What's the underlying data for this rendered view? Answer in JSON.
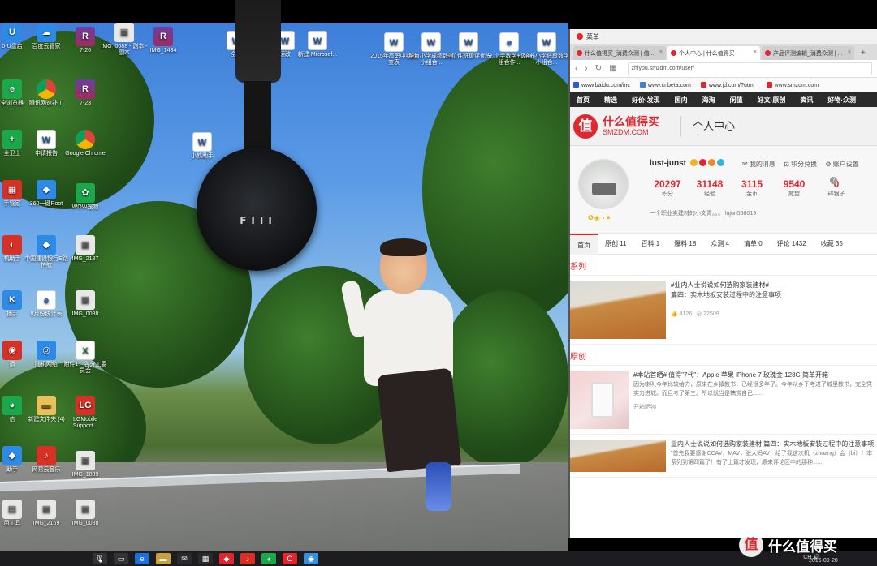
{
  "desktop": {
    "icons": [
      {
        "label": "0-U盘启",
        "icon": "app-icon",
        "cls": "shield",
        "glyph": "U"
      },
      {
        "label": "百度云管家",
        "icon": "cloud-icon",
        "cls": "shield",
        "glyph": "☁"
      },
      {
        "label": "7-26",
        "icon": "archive-icon",
        "cls": "rar",
        "glyph": "R"
      },
      {
        "label": "IMG_0088 - 副本 - 副本",
        "icon": "image-icon",
        "cls": "img",
        "glyph": "▣"
      },
      {
        "label": "IMG_1434",
        "icon": "archive-icon",
        "cls": "rar",
        "glyph": "R"
      },
      {
        "label": "全兑",
        "icon": "word-icon",
        "cls": "word",
        "glyph": "W"
      },
      {
        "label": "读改",
        "icon": "word-icon",
        "cls": "word",
        "glyph": "W"
      },
      {
        "label": "新建 Microsof...",
        "icon": "word-icon",
        "cls": "word",
        "glyph": "W"
      },
      {
        "label": "2015年高职中期检查表",
        "icon": "word-icon",
        "cls": "word",
        "glyph": "W"
      },
      {
        "label": "培育小学成绩数学小组合...",
        "icon": "word-icon",
        "cls": "word",
        "glyph": "W"
      },
      {
        "label": "三位件班级评优先",
        "icon": "word-icon",
        "cls": "word",
        "glyph": "W"
      },
      {
        "label": "分 小学数学+级小组合作...",
        "icon": "pdf-icon",
        "cls": "pdf",
        "glyph": "e"
      },
      {
        "label": "培养小学低段数学小组合...",
        "icon": "word-icon",
        "cls": "word",
        "glyph": "W"
      },
      {
        "label": "全浏览器",
        "icon": "browser-icon",
        "cls": "green",
        "glyph": "e"
      },
      {
        "label": "腾讯网速补丁",
        "icon": "chrome-icon",
        "cls": "chrome",
        "glyph": ""
      },
      {
        "label": "7-23",
        "icon": "archive-icon",
        "cls": "rar",
        "glyph": "R"
      },
      {
        "label": "全卫士",
        "icon": "shield-icon",
        "cls": "green",
        "glyph": "+"
      },
      {
        "label": "申请报告",
        "icon": "word-icon",
        "cls": "word",
        "glyph": "W"
      },
      {
        "label": "Google Chrome",
        "icon": "chrome-icon",
        "cls": "chrome",
        "glyph": ""
      },
      {
        "label": "小鹤助手",
        "icon": "word-icon",
        "cls": "word",
        "glyph": "W"
      },
      {
        "label": "手管家",
        "icon": "app-icon",
        "cls": "red",
        "glyph": "▦"
      },
      {
        "label": "360一键Root",
        "icon": "shield-icon",
        "cls": "shield",
        "glyph": "◆"
      },
      {
        "label": "WOW宠物",
        "icon": "paw-icon",
        "cls": "green",
        "glyph": "✿"
      },
      {
        "label": "机助手",
        "icon": "app-icon",
        "cls": "red",
        "glyph": "◐"
      },
      {
        "label": "中国建设银行E路护航",
        "icon": "bank-icon",
        "cls": "shield",
        "glyph": "◆"
      },
      {
        "label": "IMG_2187",
        "icon": "image-icon",
        "cls": "img",
        "glyph": "▣"
      },
      {
        "label": "播手",
        "icon": "app-icon",
        "cls": "shield",
        "glyph": "K"
      },
      {
        "label": "8月份统计表",
        "icon": "pdf-icon",
        "cls": "pdf",
        "glyph": "e"
      },
      {
        "label": "IMG_0088",
        "icon": "image-icon",
        "cls": "img",
        "glyph": "▣"
      },
      {
        "label": "播",
        "icon": "app-icon",
        "cls": "red",
        "glyph": "◉"
      },
      {
        "label": "随机网络",
        "icon": "network-icon",
        "cls": "shield",
        "glyph": "◎"
      },
      {
        "label": "附件1：各分工委员会",
        "icon": "excel-icon",
        "cls": "xls",
        "glyph": "X"
      },
      {
        "label": "信",
        "icon": "chat-icon",
        "cls": "green",
        "glyph": "◕"
      },
      {
        "label": "新建文件夹 (4)",
        "icon": "folder-icon",
        "cls": "folder",
        "glyph": "▬"
      },
      {
        "label": "LGMobile Support...",
        "icon": "lg-icon",
        "cls": "red",
        "glyph": "LG"
      },
      {
        "label": "助手",
        "icon": "app-icon",
        "cls": "shield",
        "glyph": "◆"
      },
      {
        "label": "网易云音乐",
        "icon": "music-icon",
        "cls": "red",
        "glyph": "♪"
      },
      {
        "label": "IMG_1889",
        "icon": "image-icon",
        "cls": "img",
        "glyph": "▣"
      },
      {
        "label": "用工具",
        "icon": "app-icon",
        "cls": "img",
        "glyph": "▤"
      },
      {
        "label": "IMG_2169",
        "icon": "image-icon",
        "cls": "img",
        "glyph": "▣"
      },
      {
        "label": "IMG_0088",
        "icon": "image-icon",
        "cls": "img",
        "glyph": "▣"
      }
    ],
    "headphone_logo": "FIII"
  },
  "browser": {
    "title": "菜单",
    "tabs": [
      {
        "label": "什么值得买_消费众测 | 值...",
        "active": false
      },
      {
        "label": "个人中心 | 什么值得买",
        "active": true
      },
      {
        "label": "产品评测编辑_消费众测 | ...",
        "active": false
      }
    ],
    "new_tab": "+",
    "url": "zhiyou.smzdm.com/user/",
    "bookmarks": [
      {
        "label": "www.baidu.com/inc",
        "color": "#2d58d8"
      },
      {
        "label": "www.cnbeta.com",
        "color": "#3f7fd6"
      },
      {
        "label": "www.jd.com/?utm_",
        "color": "#e0262f"
      },
      {
        "label": "www.smzdm.com",
        "color": "#e0262f"
      }
    ],
    "site_nav": [
      "首页",
      "精选",
      "好价·发现",
      "国内",
      "海淘",
      "闲值",
      "好文·原创",
      "资讯",
      "好物·众测"
    ],
    "brand": {
      "mark": "值",
      "name": "什么值得买",
      "domain": "SMZDM.COM",
      "section": "个人中心"
    },
    "profile": {
      "username": "lust-junst",
      "links": [
        "我的消息",
        "积分兑换",
        "账户设置"
      ],
      "stats": [
        {
          "value": "20297",
          "label": "积分"
        },
        {
          "value": "31148",
          "label": "经验"
        },
        {
          "value": "3115",
          "label": "金币"
        },
        {
          "value": "9540",
          "label": "威望"
        },
        {
          "value": "0",
          "label": "碎银子"
        }
      ],
      "help": "?",
      "bio": "一个职业卖建材的小文青。。。 lujun558019",
      "medals": "✪◉◑★"
    },
    "profile_tabs": [
      "首页",
      "原创 11",
      "百科 1",
      "爆料 18",
      "众测 4",
      "清单 0",
      "评论 1432",
      "收藏 35"
    ],
    "series_heading": "系列",
    "series": [
      {
        "title": "#业内人士说说如何选购家装建材#",
        "subtitle": "篇四：实木地板安装过程中的注意事项",
        "likes": "4126",
        "views": "22509"
      }
    ],
    "original_heading": "原创",
    "originals": [
      {
        "title": "#本站首晒# 值得\"7代\"：Apple 苹果 iPhone 7 玫瑰金 128G 简单开箱",
        "body": "因为喇叭今年比较给力，原来在乡镇教书，已经很多年了。今年从乡下考进了城里教书，完全凭实力进城。而且考了第三。所以就当是犒赏自己......",
        "tag": "开箱晒物"
      },
      {
        "title": "业内人士说说如何选购家装建材 篇四：实木地板安装过程中的注意事项",
        "body": "\"首先我要感谢CCAV，MAV，张大妈AV！给了我这次机（zhuang）会（bi）！本系列到第四篇了！有了上篇才发现，原来评论区中的那种......",
        "tag": ""
      }
    ]
  },
  "taskbar": {
    "items": [
      {
        "name": "mic-icon",
        "glyph": "🎙"
      },
      {
        "name": "task-view-icon",
        "glyph": "▭"
      },
      {
        "name": "edge-icon",
        "glyph": "e"
      },
      {
        "name": "explorer-icon",
        "glyph": "▬"
      },
      {
        "name": "mail-icon",
        "glyph": "✉"
      },
      {
        "name": "store-icon",
        "glyph": "▦"
      },
      {
        "name": "app-red-icon",
        "glyph": "◆"
      },
      {
        "name": "netease-icon",
        "glyph": "♪"
      },
      {
        "name": "wechat-icon",
        "glyph": "◕"
      },
      {
        "name": "opera-icon",
        "glyph": "O"
      },
      {
        "name": "chrome-taskbar-icon",
        "glyph": "◉"
      }
    ],
    "tray": "CH 🔊",
    "date": "2016-09-20"
  },
  "watermark": {
    "mark": "值",
    "text": "什么值得买"
  }
}
